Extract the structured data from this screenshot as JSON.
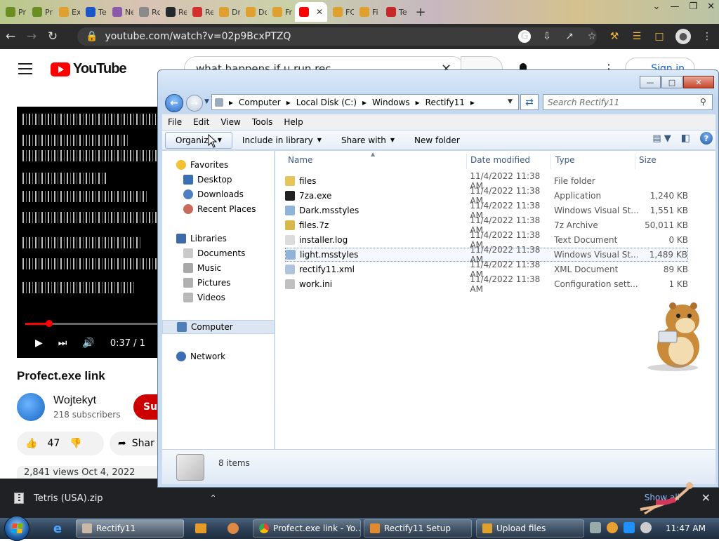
{
  "browser": {
    "tabs": [
      {
        "label": "Pr",
        "color": "#6b8e23"
      },
      {
        "label": "Pr",
        "color": "#6b8e23"
      },
      {
        "label": "Ex",
        "color": "#e0a030"
      },
      {
        "label": "Te",
        "color": "#1a56c8"
      },
      {
        "label": "Ne",
        "color": "#8a5aa8"
      },
      {
        "label": "Rc",
        "color": "#8a8a8a"
      },
      {
        "label": "Re",
        "color": "#24292e"
      },
      {
        "label": "Re",
        "color": "#d32f2f"
      },
      {
        "label": "Dr",
        "color": "#e0a030"
      },
      {
        "label": "Dc",
        "color": "#e0a030"
      },
      {
        "label": "Fr",
        "color": "#e0a030"
      },
      {
        "label": "",
        "color": "#ff0000",
        "close": "✕"
      },
      {
        "label": "FC",
        "color": "#e0a030"
      },
      {
        "label": "Fi",
        "color": "#e0a030"
      },
      {
        "label": "Te",
        "color": "#c62828"
      }
    ],
    "new_tab": "+",
    "window_controls": [
      "⌄",
      "—",
      "❐",
      "✕"
    ],
    "url": "youtube.com/watch?v=02p9BcxPTZQ",
    "google_g": "G"
  },
  "youtube": {
    "logo_word": "YouTube",
    "search_query": "what happens if u run rec",
    "sign_in": "Sign in",
    "video_time": "0:37 / 1",
    "video_progress_fraction": 0.17,
    "title": "Profect.exe link",
    "channel": "Wojtekyt",
    "subscribers": "218 subscribers",
    "subscribe": "Sub",
    "likes": "47",
    "share": "Shar",
    "views_partial": "2,841 views  Oct 4, 2022"
  },
  "download_shelf": {
    "filename": "Tetris (USA).zip",
    "show_all": "Show all"
  },
  "explorer": {
    "breadcrumb": [
      "Computer",
      "Local Disk (C:)",
      "Windows",
      "Rectify11"
    ],
    "search_placeholder": "Search Rectify11",
    "menu": [
      "File",
      "Edit",
      "View",
      "Tools",
      "Help"
    ],
    "commands": {
      "organize": "Organize",
      "include_in_library": "Include in library",
      "share_with": "Share with",
      "new_folder": "New folder"
    },
    "nav": {
      "favorites": "Favorites",
      "desktop": "Desktop",
      "downloads": "Downloads",
      "recent_places": "Recent Places",
      "libraries": "Libraries",
      "documents": "Documents",
      "music": "Music",
      "pictures": "Pictures",
      "videos": "Videos",
      "computer": "Computer",
      "network": "Network"
    },
    "columns": {
      "name": "Name",
      "date": "Date modified",
      "type": "Type",
      "size": "Size"
    },
    "files": [
      {
        "name": "files",
        "date": "11/4/2022 11:38 AM",
        "type": "File folder",
        "size": "",
        "icon": "#e6c55a"
      },
      {
        "name": "7za.exe",
        "date": "11/4/2022 11:38 AM",
        "type": "Application",
        "size": "1,240 KB",
        "icon": "#222222"
      },
      {
        "name": "Dark.msstyles",
        "date": "11/4/2022 11:38 AM",
        "type": "Windows Visual St...",
        "size": "1,551 KB",
        "icon": "#8fb4d8"
      },
      {
        "name": "files.7z",
        "date": "11/4/2022 11:38 AM",
        "type": "7z Archive",
        "size": "50,011 KB",
        "icon": "#d6b94a"
      },
      {
        "name": "installer.log",
        "date": "11/4/2022 11:38 AM",
        "type": "Text Document",
        "size": "0 KB",
        "icon": "#dcdcdc"
      },
      {
        "name": "light.msstyles",
        "date": "11/4/2022 11:38 AM",
        "type": "Windows Visual St...",
        "size": "1,489 KB",
        "icon": "#8fb4d8"
      },
      {
        "name": "rectify11.xml",
        "date": "11/4/2022 11:38 AM",
        "type": "XML Document",
        "size": "89 KB",
        "icon": "#b0c4de"
      },
      {
        "name": "work.ini",
        "date": "11/4/2022 11:38 AM",
        "type": "Configuration sett...",
        "size": "1 KB",
        "icon": "#c0c0c0"
      }
    ],
    "item_count": "8 items"
  },
  "taskbar": {
    "buttons": [
      {
        "label": "Rectify11",
        "color": "#c9b8a8"
      },
      {
        "label": "Profect.exe link - Yo...",
        "color": "#e0a030"
      },
      {
        "label": "Rectify11 Setup",
        "color": "#e08a30"
      },
      {
        "label": "Upload files",
        "color": "#e0a030"
      }
    ],
    "clock": "11:47 AM"
  }
}
